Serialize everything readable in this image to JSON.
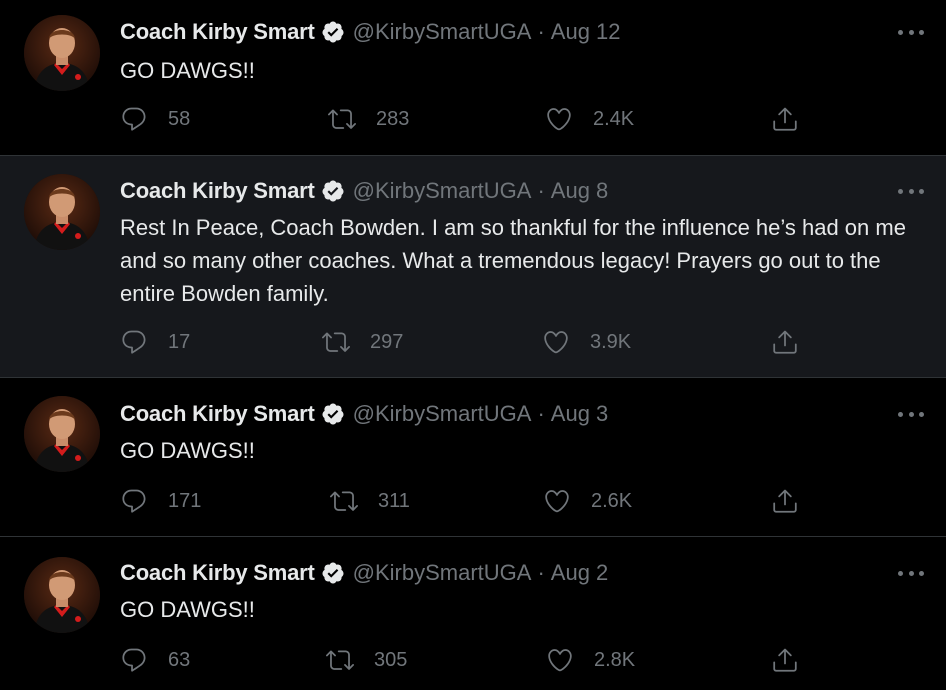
{
  "colors": {
    "background": "#000000",
    "highlight_background": "#16181c",
    "primary_text": "#e7e9ea",
    "secondary_text": "#71767b",
    "divider": "#2f3336"
  },
  "icons": {
    "verified": "verified-badge-icon",
    "more": "more-options-icon",
    "reply": "reply-icon",
    "retweet": "retweet-icon",
    "like": "heart-icon",
    "share": "share-icon"
  },
  "tweets": [
    {
      "name": "Coach Kirby Smart",
      "handle": "@KirbySmartUGA",
      "separator": "·",
      "date": "Aug 12",
      "text": "GO DAWGS!!",
      "replies": "58",
      "retweets": "283",
      "likes": "2.4K"
    },
    {
      "name": "Coach Kirby Smart",
      "handle": "@KirbySmartUGA",
      "separator": "·",
      "date": "Aug 8",
      "text": "Rest In Peace, Coach Bowden. I am so thankful for the influence he’s had on me and so many other coaches. What a tremendous legacy! Prayers go out to the entire Bowden family.",
      "replies": "17",
      "retweets": "297",
      "likes": "3.9K"
    },
    {
      "name": "Coach Kirby Smart",
      "handle": "@KirbySmartUGA",
      "separator": "·",
      "date": "Aug 3",
      "text": "GO DAWGS!!",
      "replies": "171",
      "retweets": "311",
      "likes": "2.6K"
    },
    {
      "name": "Coach Kirby Smart",
      "handle": "@KirbySmartUGA",
      "separator": "·",
      "date": "Aug 2",
      "text": "GO DAWGS!!",
      "replies": "63",
      "retweets": "305",
      "likes": "2.8K"
    }
  ]
}
